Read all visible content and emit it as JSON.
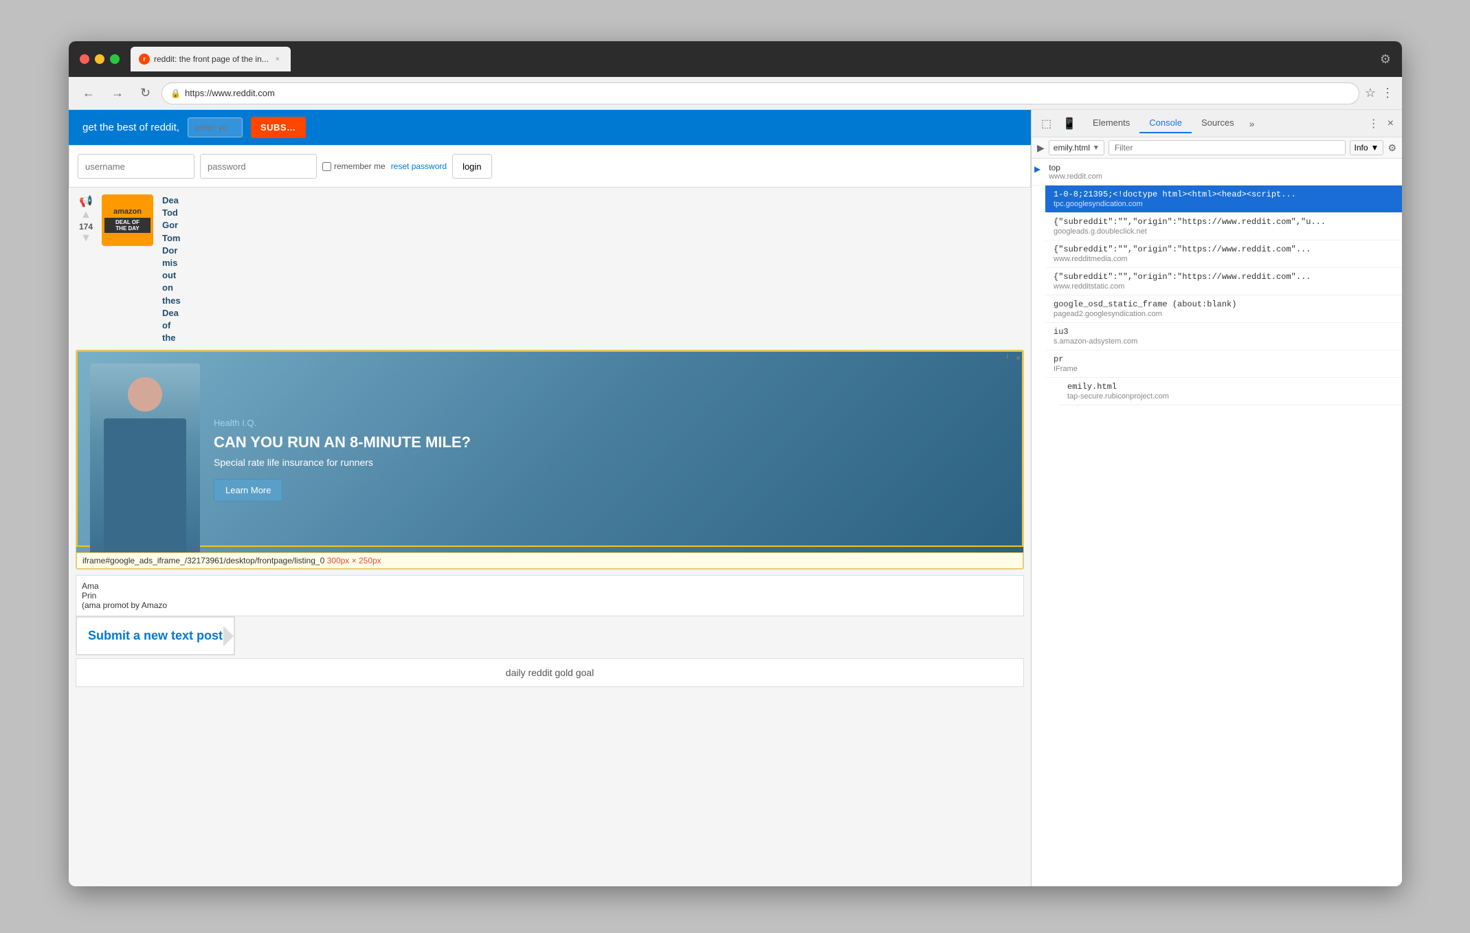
{
  "browser": {
    "title": "reddit: the front page of the in...",
    "url": "https://www.reddit.com",
    "tab_label": "reddit: the front page of the in...",
    "tab_close": "×"
  },
  "header": {
    "text": "get the best of reddit,",
    "enter_placeholder": "enter yo",
    "subscribe_label": "SUBSCRIB..."
  },
  "login": {
    "username_placeholder": "username",
    "password_placeholder": "password",
    "login_label": "login",
    "remember_label": "remember me",
    "reset_label": "reset password"
  },
  "post": {
    "vote_count": "174",
    "title_lines": [
      "Dea",
      "Tod",
      "Gor",
      "Tom",
      "Dor",
      "mis",
      "out",
      "on",
      "thes",
      "Dea",
      "of",
      "the"
    ],
    "amazon_line1": "amazon",
    "amazon_deal_line1": "DEAL OF",
    "amazon_deal_line2": "THE DAY"
  },
  "ad": {
    "brand": "Health I.Q.",
    "headline": "CAN YOU RUN AN 8-MINUTE MILE?",
    "subtext": "Special rate life insurance for runners",
    "cta": "Learn More",
    "badge": "i",
    "close": "×"
  },
  "iframe_tooltip": {
    "text": "iframe#google_ads_iframe_/32173961/desktop/frontpage/listing_0",
    "dims": "300px × 250px"
  },
  "amazon_promo": {
    "line1": "Ama",
    "line2": "Prin",
    "meta": "(ama promot by Amazo"
  },
  "submit_post": {
    "label": "Submit a new text post"
  },
  "gold_goal": {
    "label": "daily reddit gold goal"
  },
  "devtools": {
    "tabs": [
      "Elements",
      "Console",
      "Sources"
    ],
    "active_tab": "Console",
    "context_file": "emily.html",
    "filter_placeholder": "Filter",
    "info_label": "Info",
    "console_items": [
      {
        "id": "top",
        "label": "top",
        "origin": "www.reddit.com",
        "selected": false,
        "indent": 0,
        "arrow": "▶"
      },
      {
        "id": "doctype",
        "label": "1-0-8;21395;<!doctype html><html><head><script...",
        "origin": "tpc.googlesyndication.com",
        "selected": true,
        "indent": 1
      },
      {
        "id": "googleads",
        "label": "{\"subreddit\":\"\",\"origin\":\"https://www.reddit.com\",\"u...",
        "origin": "googleads.g.doubleclick.net",
        "selected": false,
        "indent": 1
      },
      {
        "id": "redditmedia",
        "label": "{\"subreddit\":\"\",\"origin\":\"https://www.reddit.com\"...",
        "origin": "www.redditmedia.com",
        "selected": false,
        "indent": 1
      },
      {
        "id": "redditstatic",
        "label": "{\"subreddit\":\"\",\"origin\":\"https://www.reddit.com\"...",
        "origin": "www.redditstatic.com",
        "selected": false,
        "indent": 1
      },
      {
        "id": "google_osd",
        "label": "google_osd_static_frame (about:blank)",
        "origin": "pagead2.googlesyndication.com",
        "selected": false,
        "indent": 1
      },
      {
        "id": "iu3",
        "label": "iu3",
        "origin": "s.amazon-adsystem.com",
        "selected": false,
        "indent": 1
      },
      {
        "id": "pr",
        "label": "pr",
        "origin": "IFrame",
        "selected": false,
        "indent": 1
      },
      {
        "id": "emily",
        "label": "emily.html",
        "origin": "tap-secure.rubiconproject.com",
        "selected": false,
        "indent": 2
      }
    ]
  }
}
